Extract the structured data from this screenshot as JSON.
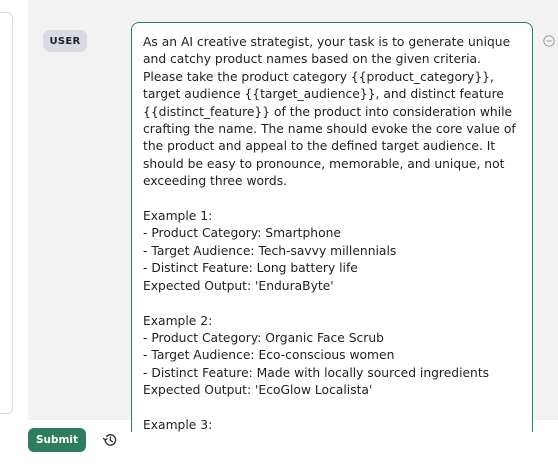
{
  "message": {
    "role": "USER",
    "content": "As an AI creative strategist, your task is to generate unique and catchy product names based on the given criteria. Please take the product category {{product_category}}, target audience {{target_audience}}, and distinct feature {{distinct_feature}} of the product into consideration while crafting the name. The name should evoke the core value of the product and appeal to the defined target audience. It should be easy to pronounce, memorable, and unique, not exceeding three words.\n\nExample 1:\n- Product Category: Smartphone\n- Target Audience: Tech-savvy millennials\n- Distinct Feature: Long battery life\nExpected Output: 'EnduraByte'\n\nExample 2:\n- Product Category: Organic Face Scrub\n- Target Audience: Eco-conscious women\n- Distinct Feature: Made with locally sourced ingredients\nExpected Output: 'EcoGlow Localista'\n\nExample 3:"
  },
  "actions": {
    "submit_label": "Submit"
  },
  "icons": {
    "remove": "minus-circle-icon",
    "history": "history-icon"
  },
  "colors": {
    "accent": "#2e7d5f",
    "badge_bg": "#d9dbe3",
    "panel_bg": "#f2f2f2"
  }
}
